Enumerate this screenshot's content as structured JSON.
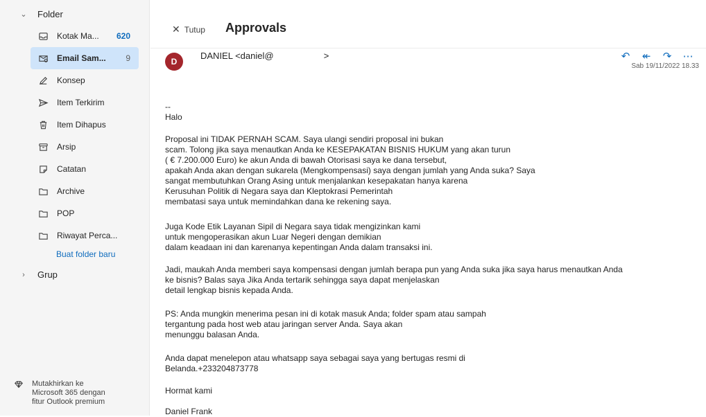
{
  "sidebar": {
    "folder_header": "Folder",
    "items": [
      {
        "label": "Kotak Ma...",
        "count": "620"
      },
      {
        "label": "Email Sam...",
        "count": "9"
      },
      {
        "label": "Konsep"
      },
      {
        "label": "Item Terkirim"
      },
      {
        "label": "Item Dihapus"
      },
      {
        "label": "Arsip"
      },
      {
        "label": "Catatan"
      },
      {
        "label": "Archive"
      },
      {
        "label": "POP"
      },
      {
        "label": "Riwayat Perca..."
      }
    ],
    "new_folder": "Buat folder baru",
    "group_header": "Grup",
    "upgrade": {
      "line1": "Mutakhirkan ke",
      "line2": "Microsoft 365 dengan",
      "line3": "fitur Outlook premium"
    }
  },
  "reading": {
    "close_label": "Tutup",
    "subject": "Approvals",
    "avatar_initial": "D",
    "sender": "DANIEL <daniel@                    >",
    "date": "Sab 19/11/2022 18.33",
    "body": [
      "--",
      "Halo",
      "Proposal ini TIDAK PERNAH SCAM. Saya ulangi sendiri proposal ini bukan",
      "scam. Tolong jika saya menautkan Anda ke KESEPAKATAN BISNIS HUKUM yang akan turun",
      "( € 7.200.000 Euro) ke akun Anda di bawah Otorisasi saya ke dana tersebut,",
      "apakah Anda akan dengan sukarela (Mengkompensasi) saya dengan jumlah yang Anda suka? Saya",
      "sangat membutuhkan Orang Asing untuk menjalankan kesepakatan hanya karena",
      "Kerusuhan Politik di Negara saya dan Kleptokrasi Pemerintah",
      "membatasi saya untuk memindahkan dana ke rekening saya.",
      "Juga Kode Etik Layanan Sipil di Negara saya tidak mengizinkan kami",
      "untuk mengoperasikan akun Luar Negeri dengan demikian",
      "dalam keadaan ini dan karenanya kepentingan Anda dalam transaksi ini.",
      "Jadi, maukah Anda memberi saya kompensasi dengan jumlah berapa pun yang Anda suka jika saya harus menautkan Anda",
      "ke bisnis? Balas saya Jika Anda tertarik sehingga saya dapat menjelaskan",
      "detail lengkap bisnis kepada Anda.",
      "PS: Anda mungkin menerima pesan ini di kotak masuk Anda; folder spam atau sampah",
      "tergantung pada host web atau jaringan server Anda. Saya akan",
      "menunggu balasan Anda.",
      "Anda dapat menelepon atau whatsapp saya sebagai saya yang bertugas resmi di",
      "Belanda.+233204873778",
      "Hormat kami",
      "Daniel Frank"
    ]
  },
  "colors": {
    "accent": "#0f6cbd",
    "selected_bg": "#cfe4fa",
    "avatar_bg": "#a4262c"
  }
}
